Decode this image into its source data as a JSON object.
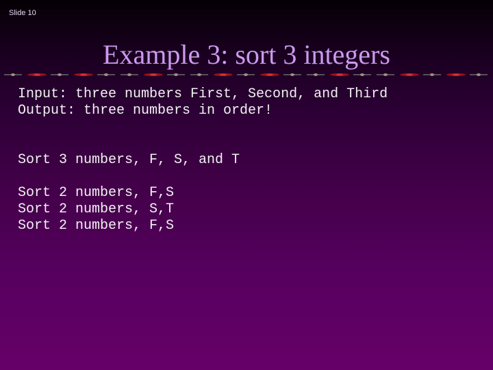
{
  "slide": {
    "number_label": "Slide 10",
    "title": "Example 3: sort 3 integers",
    "title_color": "#cc99ee",
    "divider_icon": "rose-vine-border"
  },
  "content": {
    "io": [
      "Input: three numbers First, Second, and Third",
      "Output: three numbers in order!"
    ],
    "summary": "Sort 3 numbers, F, S, and T",
    "steps": [
      "Sort 2 numbers, F,S",
      "Sort 2 numbers, S,T",
      "Sort 2 numbers, F,S"
    ]
  }
}
